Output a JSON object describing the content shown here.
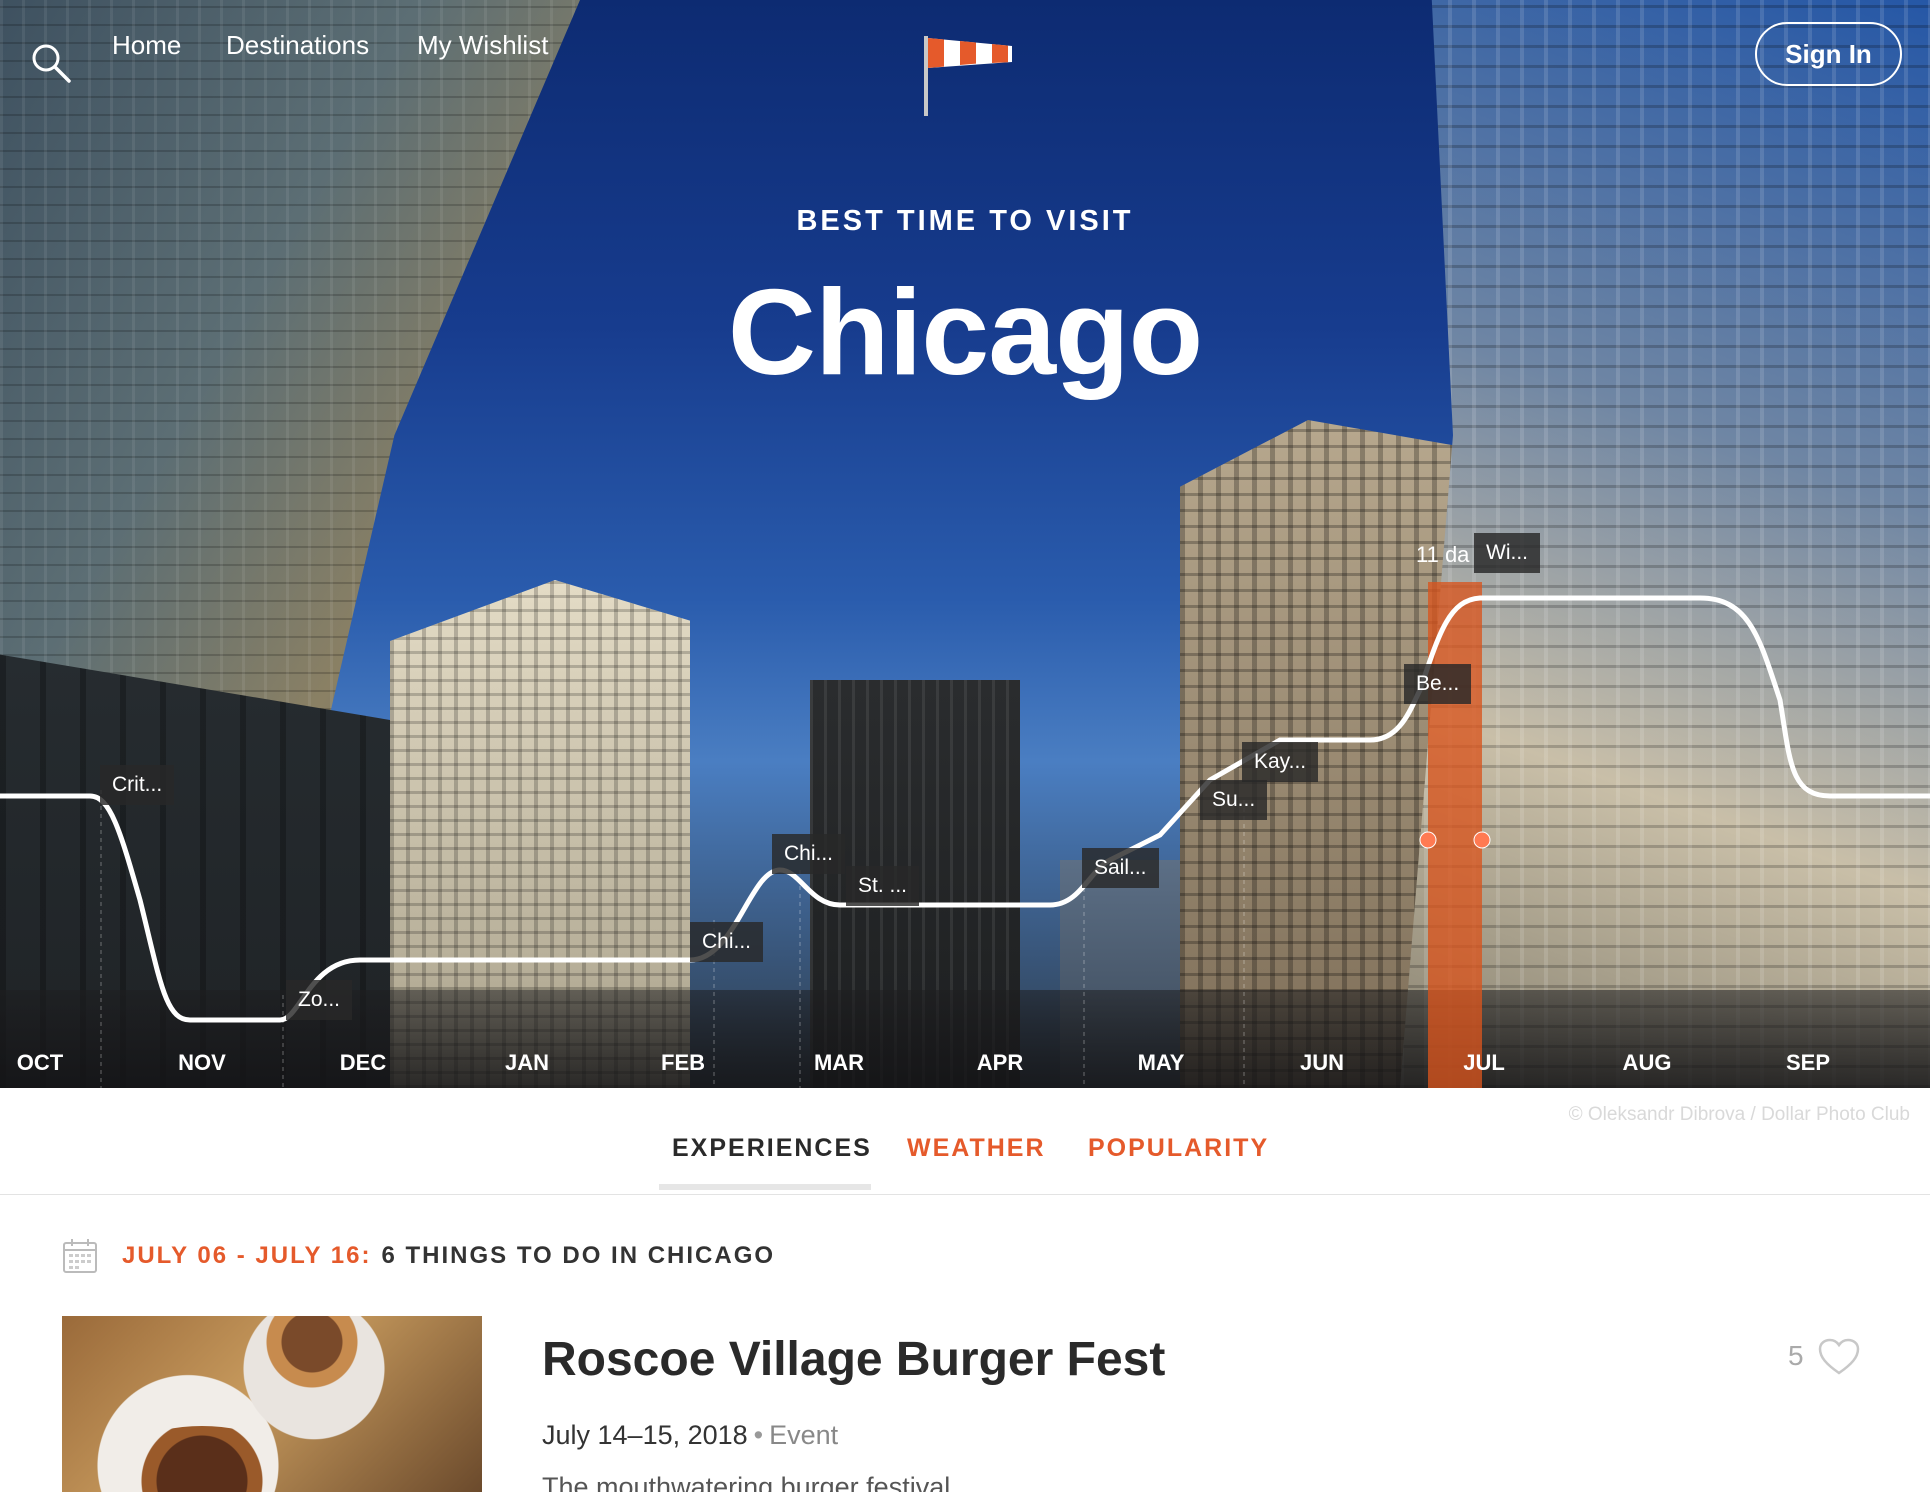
{
  "nav": {
    "home": "Home",
    "destinations": "Destinations",
    "wishlist": "My Wishlist",
    "signin": "Sign In"
  },
  "hero": {
    "kicker": "BEST TIME TO VISIT",
    "city": "Chicago",
    "credit": "© Oleksandr Dibrova / Dollar Photo Club"
  },
  "chart": {
    "months": [
      "OCT",
      "NOV",
      "DEC",
      "JAN",
      "FEB",
      "MAR",
      "APR",
      "MAY",
      "JUN",
      "JUL",
      "AUG",
      "SEP"
    ],
    "highlight": {
      "month": "JUL",
      "label": "11 da"
    },
    "events": [
      "Crit...",
      "Zo...",
      "Chi...",
      "Chi...",
      "St. ...",
      "Sail...",
      "Su...",
      "Kay...",
      "Be...",
      "Wi..."
    ],
    "colors": {
      "line": "#ffffff",
      "highlight": "#d9541e"
    }
  },
  "tabs": {
    "experiences": "EXPERIENCES",
    "weather": "WEATHER",
    "popularity": "POPULARITY",
    "active": "EXPERIENCES",
    "accent": "#e55a2b"
  },
  "section": {
    "dates": "JULY 06 - JULY 16:",
    "title": "6 THINGS TO DO IN CHICAGO"
  },
  "item": {
    "title": "Roscoe Village Burger Fest",
    "date": "July 14–15, 2018",
    "separator": "•",
    "type": "Event",
    "description": "The mouthwatering burger festival",
    "likes": "5"
  },
  "icons": {
    "search": "search-icon",
    "logo": "windsock-logo-icon",
    "calendar": "calendar-icon",
    "heart": "heart-icon"
  }
}
